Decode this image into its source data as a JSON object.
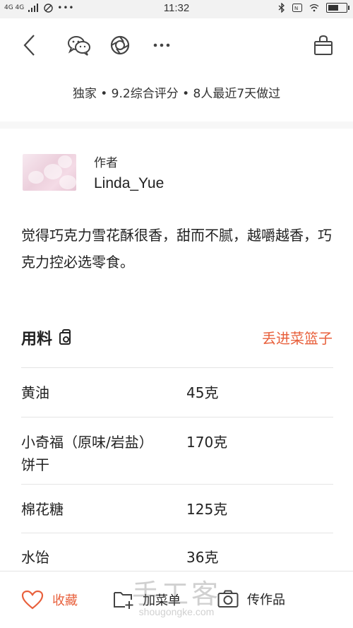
{
  "status_bar": {
    "network": "4G 4G",
    "time": "11:32",
    "battery_level": 0.6
  },
  "toolbar": {
    "back_icon": "chevron-left-icon",
    "wechat_icon": "wechat-icon",
    "moments_icon": "camera-shutter-icon",
    "more_icon": "more-dots-icon",
    "basket_icon": "shopping-bag-icon"
  },
  "summary": "独家 • 9.2综合评分 • 8人最近7天做过",
  "author": {
    "role": "作者",
    "name": "Linda_Yue"
  },
  "description": "觉得巧克力雪花酥很香，甜而不腻，越嚼越香，巧克力控必选零食。",
  "ingredients": {
    "title": "用料",
    "basket_label": "丢进菜篮子",
    "items": [
      {
        "name": "黄油",
        "qty": "45克"
      },
      {
        "name": "小奇福（原味/岩盐）饼干",
        "qty": "170克"
      },
      {
        "name": "棉花糖",
        "qty": "125克"
      },
      {
        "name": "水饴",
        "qty": "36克"
      }
    ]
  },
  "bottom_bar": {
    "favorite": "收藏",
    "add_menu": "加菜单",
    "upload": "传作品"
  },
  "watermark": {
    "text": "手工客",
    "url": "shougongke.com"
  },
  "colors": {
    "accent": "#e8603c",
    "divider": "#e4e4e4"
  }
}
